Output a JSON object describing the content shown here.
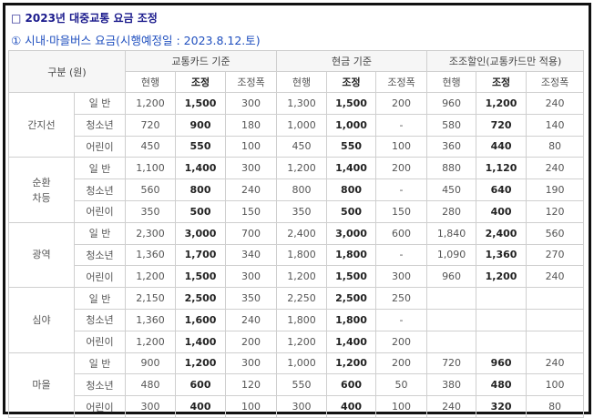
{
  "title": "□ 2023년 대중교통 요금 조정",
  "subtitle": "① 시내·마을버스 요금(시행예정일 : 2023.8.12.토)",
  "headers": {
    "category": "구분 (원)",
    "groups": [
      "교통카드 기준",
      "현금 기준",
      "조조할인(교통카드만 적용)"
    ],
    "sub": [
      "현행",
      "조정",
      "조정폭"
    ]
  },
  "routes": [
    {
      "name": "간지선",
      "rows": [
        {
          "type": "일 반",
          "v": [
            "1,200",
            "1,500",
            "300",
            "1,300",
            "1,500",
            "200",
            "960",
            "1,200",
            "240"
          ]
        },
        {
          "type": "청소년",
          "v": [
            "720",
            "900",
            "180",
            "1,000",
            "1,000",
            "-",
            "580",
            "720",
            "140"
          ]
        },
        {
          "type": "어린이",
          "v": [
            "450",
            "550",
            "100",
            "450",
            "550",
            "100",
            "360",
            "440",
            "80"
          ]
        }
      ]
    },
    {
      "name": "순환\n차등",
      "rows": [
        {
          "type": "일 반",
          "v": [
            "1,100",
            "1,400",
            "300",
            "1,200",
            "1,400",
            "200",
            "880",
            "1,120",
            "240"
          ]
        },
        {
          "type": "청소년",
          "v": [
            "560",
            "800",
            "240",
            "800",
            "800",
            "-",
            "450",
            "640",
            "190"
          ]
        },
        {
          "type": "어린이",
          "v": [
            "350",
            "500",
            "150",
            "350",
            "500",
            "150",
            "280",
            "400",
            "120"
          ]
        }
      ]
    },
    {
      "name": "광역",
      "rows": [
        {
          "type": "일 반",
          "v": [
            "2,300",
            "3,000",
            "700",
            "2,400",
            "3,000",
            "600",
            "1,840",
            "2,400",
            "560"
          ]
        },
        {
          "type": "청소년",
          "v": [
            "1,360",
            "1,700",
            "340",
            "1,800",
            "1,800",
            "-",
            "1,090",
            "1,360",
            "270"
          ]
        },
        {
          "type": "어린이",
          "v": [
            "1,200",
            "1,500",
            "300",
            "1,200",
            "1,500",
            "300",
            "960",
            "1,200",
            "240"
          ]
        }
      ]
    },
    {
      "name": "심야",
      "rows": [
        {
          "type": "일 반",
          "v": [
            "2,150",
            "2,500",
            "350",
            "2,250",
            "2,500",
            "250",
            "",
            "",
            ""
          ]
        },
        {
          "type": "청소년",
          "v": [
            "1,360",
            "1,600",
            "240",
            "1,800",
            "1,800",
            "-",
            "",
            "",
            ""
          ]
        },
        {
          "type": "어린이",
          "v": [
            "1,200",
            "1,400",
            "200",
            "1,200",
            "1,400",
            "200",
            "",
            "",
            ""
          ]
        }
      ]
    },
    {
      "name": "마을",
      "rows": [
        {
          "type": "일 반",
          "v": [
            "900",
            "1,200",
            "300",
            "1,000",
            "1,200",
            "200",
            "720",
            "960",
            "240"
          ]
        },
        {
          "type": "청소년",
          "v": [
            "480",
            "600",
            "120",
            "550",
            "600",
            "50",
            "380",
            "480",
            "100"
          ]
        },
        {
          "type": "어린이",
          "v": [
            "300",
            "400",
            "100",
            "300",
            "400",
            "100",
            "240",
            "320",
            "80"
          ]
        }
      ]
    }
  ]
}
